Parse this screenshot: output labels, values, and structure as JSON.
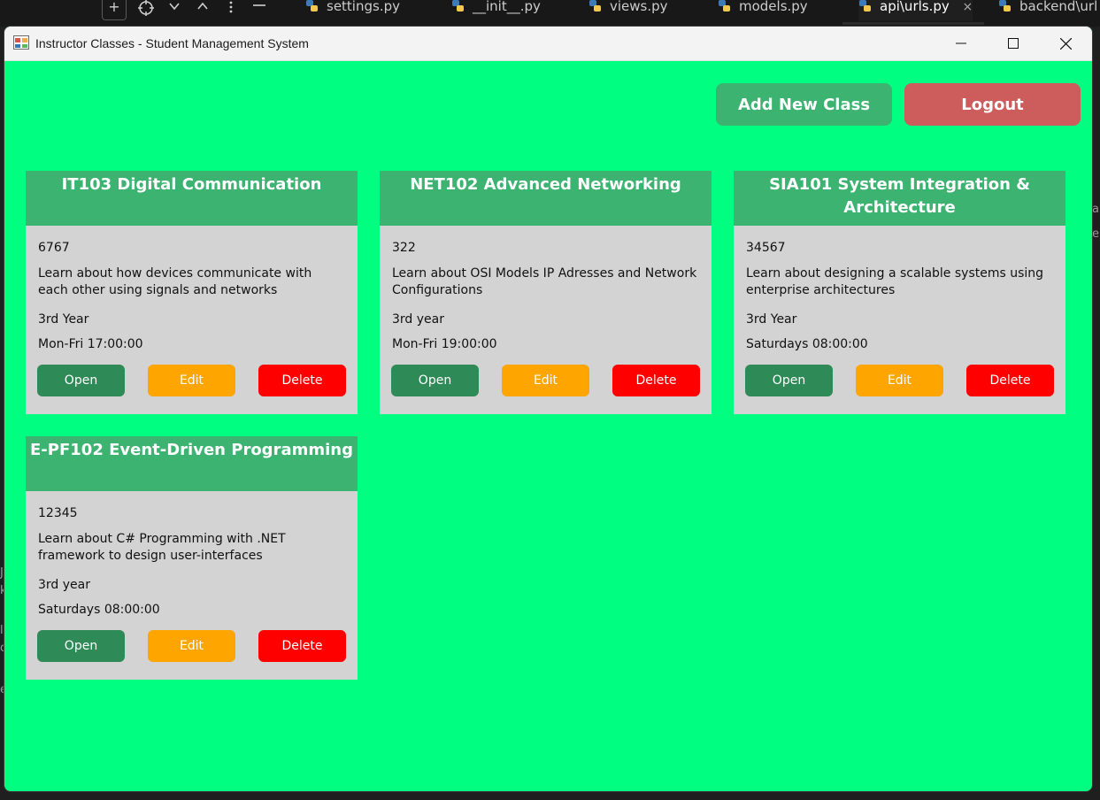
{
  "editor": {
    "tabs": [
      {
        "label": "settings.py"
      },
      {
        "label": "__init__.py"
      },
      {
        "label": "views.py"
      },
      {
        "label": "models.py"
      },
      {
        "label": "api\\urls.py",
        "close": "×"
      },
      {
        "label": "backend\\url"
      }
    ],
    "edge_right": [
      "a",
      "e"
    ],
    "edge_left": [
      "J",
      "k",
      "l",
      "o",
      "e"
    ]
  },
  "window": {
    "title": "Instructor Classes - Student Management System"
  },
  "toolbar": {
    "add_label": "Add New Class",
    "logout_label": "Logout"
  },
  "colors": {
    "background": "#00ff80",
    "card_header": "#3cb371",
    "card_body": "#d3d3d3",
    "open": "#2e8b57",
    "edit": "#ffa500",
    "delete": "#ff0000",
    "logout": "#cd5c5c"
  },
  "buttons": {
    "open": "Open",
    "edit": "Edit",
    "delete": "Delete"
  },
  "classes": [
    {
      "title": "IT103 Digital Communication",
      "code": "6767",
      "description": "Learn about how devices communicate with each other using signals and networks",
      "year": "3rd Year",
      "schedule": "Mon-Fri 17:00:00"
    },
    {
      "title": "NET102 Advanced Networking",
      "code": "322",
      "description": "Learn about OSI Models IP Adresses and Network Configurations",
      "year": "3rd year",
      "schedule": "Mon-Fri 19:00:00"
    },
    {
      "title": "SIA101 System Integration & Architecture",
      "code": "34567",
      "description": "Learn about designing a scalable systems using enterprise architectures",
      "year": "3rd Year",
      "schedule": "Saturdays 08:00:00"
    },
    {
      "title": "E-PF102 Event-Driven Programming",
      "code": "12345",
      "description": "Learn about C# Programming with .NET framework to design user-interfaces",
      "year": "3rd year",
      "schedule": "Saturdays 08:00:00"
    }
  ]
}
